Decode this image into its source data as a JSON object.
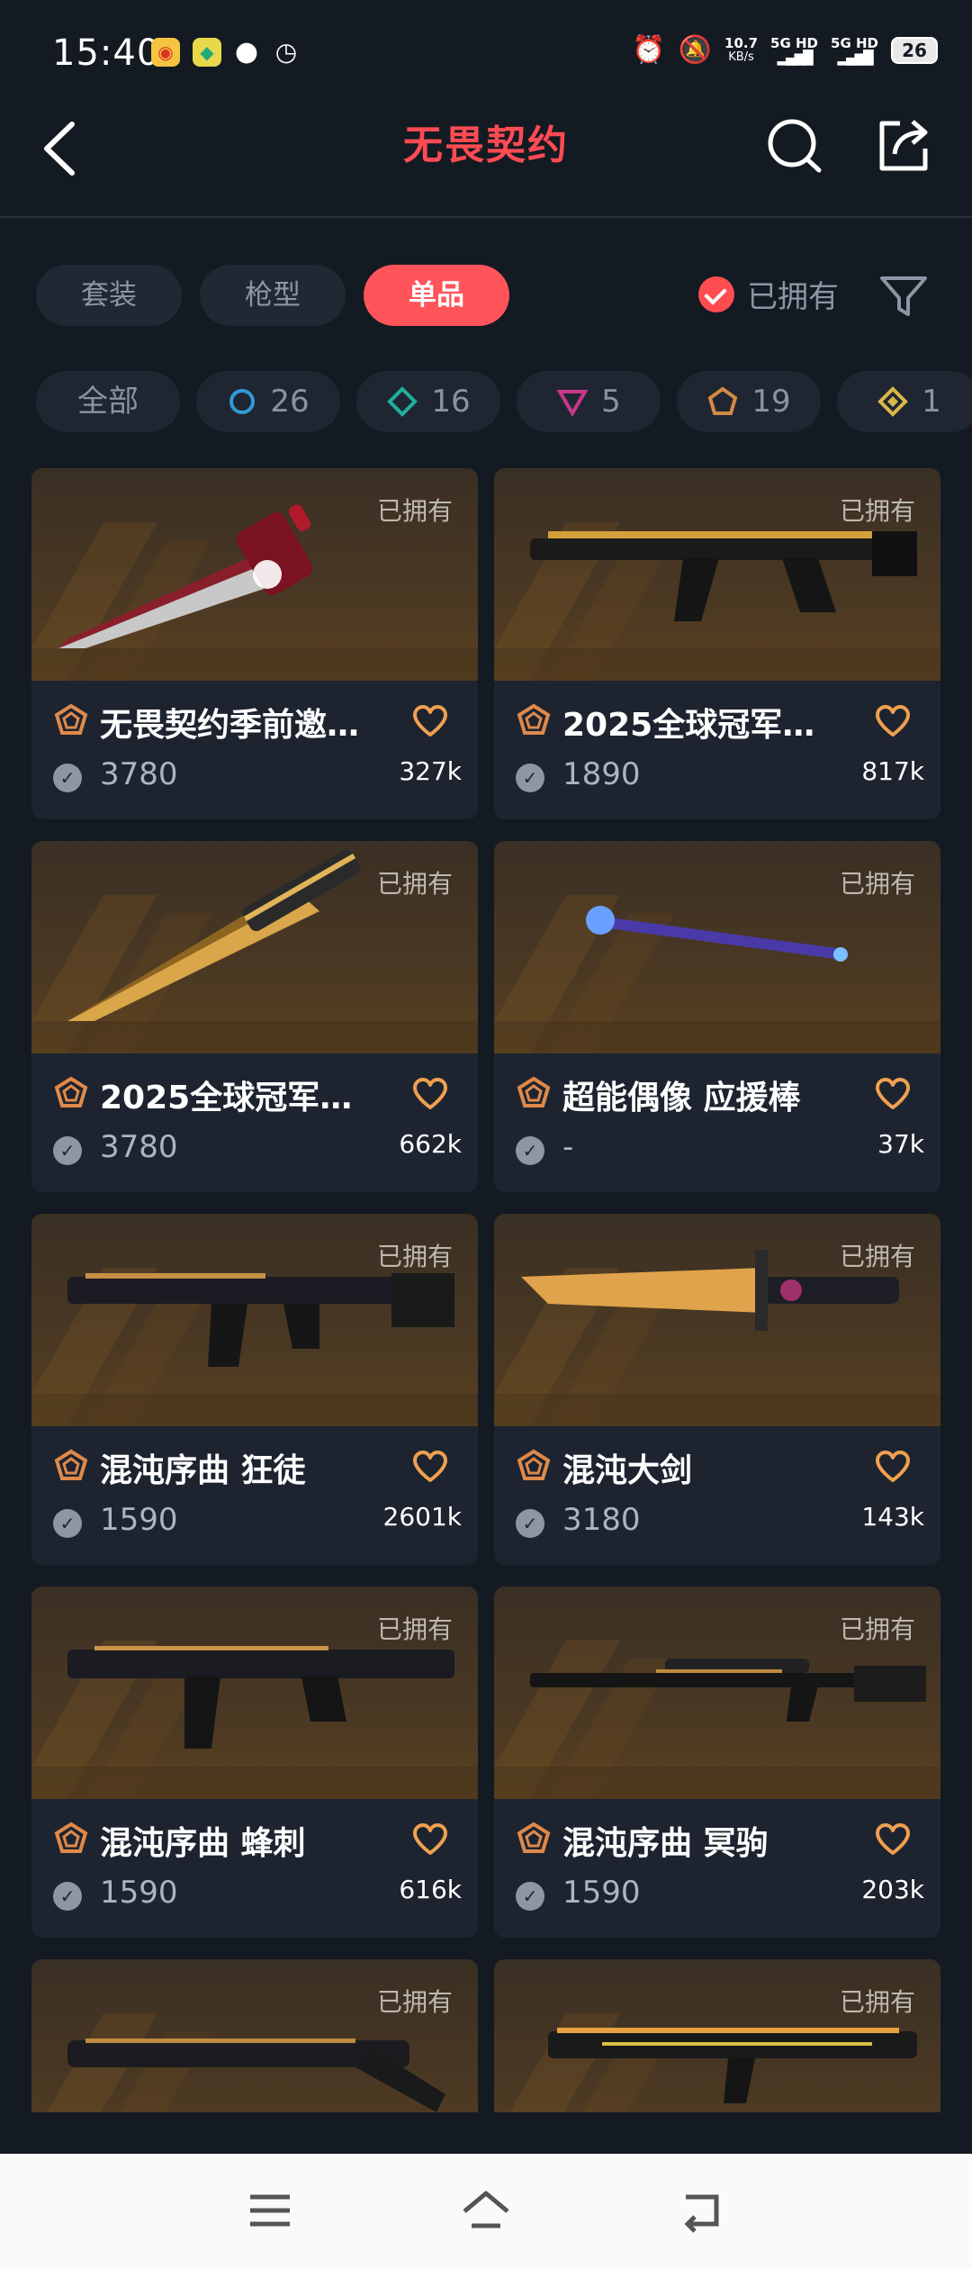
{
  "status": {
    "time": "15:40",
    "network_speed": "10.7",
    "network_speed_unit": "KB/s",
    "sim1": "5G HD",
    "sim2": "5G HD",
    "battery": "26"
  },
  "header": {
    "title": "无畏契约"
  },
  "tabs": [
    {
      "label": "套装",
      "active": false
    },
    {
      "label": "枪型",
      "active": false
    },
    {
      "label": "单品",
      "active": true
    }
  ],
  "owned_filter_label": "已拥有",
  "rarity_filters": [
    {
      "label": "全部",
      "color": ""
    },
    {
      "label": "26",
      "color": "#2f9ad8"
    },
    {
      "label": "16",
      "color": "#1faf9a"
    },
    {
      "label": "5",
      "color": "#c7378a"
    },
    {
      "label": "19",
      "color": "#d28b45"
    },
    {
      "label": "1",
      "color": "#d9b84a"
    }
  ],
  "items": [
    {
      "name": "无畏契约季前邀…",
      "price": "3780",
      "likes": "327k",
      "owned": "已拥有"
    },
    {
      "name": "2025全球冠军…",
      "price": "1890",
      "likes": "817k",
      "owned": "已拥有"
    },
    {
      "name": "2025全球冠军…",
      "price": "3780",
      "likes": "662k",
      "owned": "已拥有"
    },
    {
      "name": "超能偶像 应援棒",
      "price": "-",
      "likes": "37k",
      "owned": "已拥有"
    },
    {
      "name": "混沌序曲 狂徒",
      "price": "1590",
      "likes": "2601k",
      "owned": "已拥有"
    },
    {
      "name": "混沌大剑",
      "price": "3180",
      "likes": "143k",
      "owned": "已拥有"
    },
    {
      "name": "混沌序曲 蜂刺",
      "price": "1590",
      "likes": "616k",
      "owned": "已拥有"
    },
    {
      "name": "混沌序曲 冥驹",
      "price": "1590",
      "likes": "203k",
      "owned": "已拥有"
    },
    {
      "name": "",
      "price": "",
      "likes": "",
      "owned": "已拥有"
    },
    {
      "name": "",
      "price": "",
      "likes": "",
      "owned": "已拥有"
    }
  ],
  "colors": {
    "accent": "#ff545a",
    "background": "#141a22",
    "card": "#1d2430",
    "rank_icon": "#e0894a"
  },
  "icons": {
    "back": "chevron-left-icon",
    "search": "search-icon",
    "share": "share-icon",
    "filter": "funnel-icon",
    "heart": "heart-icon",
    "currency": "vp-coin-icon",
    "rank": "rank-badge-icon"
  }
}
